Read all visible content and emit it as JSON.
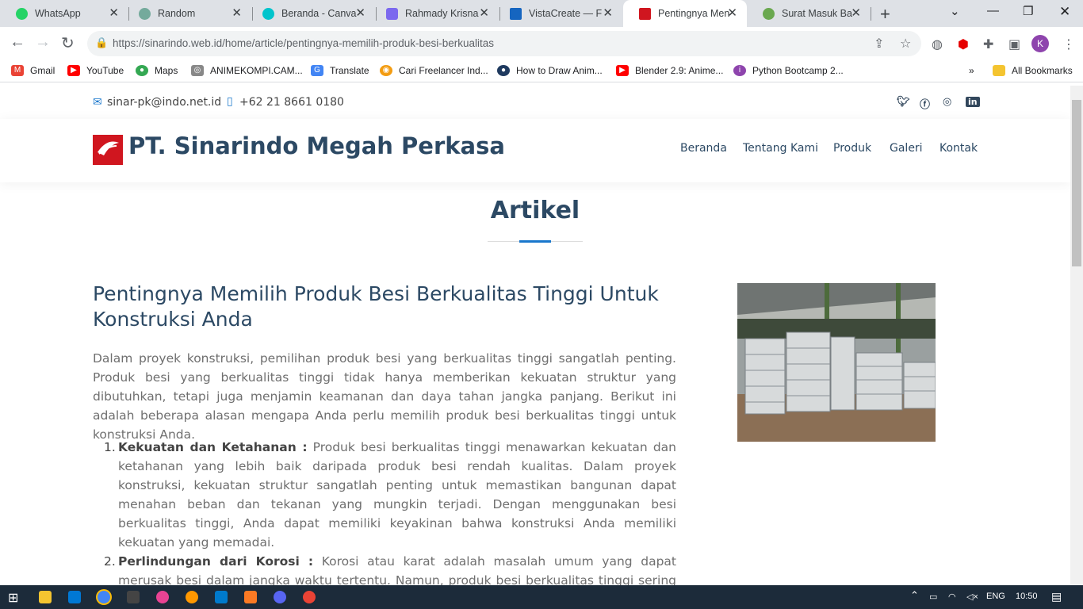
{
  "browser": {
    "tabs": [
      {
        "title": "WhatsApp",
        "color": "#25d366"
      },
      {
        "title": "Random",
        "color": "#74aa9c"
      },
      {
        "title": "Beranda - Canva",
        "color": "#00c4cc"
      },
      {
        "title": "Rahmady Krisna",
        "color": "#7b68ee"
      },
      {
        "title": "VistaCreate — F",
        "color": "#1565c0"
      },
      {
        "title": "Pentingnya Men",
        "color": "#d0161f"
      },
      {
        "title": "Surat Masuk Ba",
        "color": "#6aa84f"
      }
    ],
    "url_host": "https://sinarindo.web.id",
    "url_path": "/home/article/pentingnya-memilih-produk-besi-berkualitas",
    "avatar_letter": "K",
    "bookmarks": [
      {
        "label": "Gmail",
        "color": "#ea4335",
        "glyph": "M"
      },
      {
        "label": "YouTube",
        "color": "#ff0000",
        "glyph": "▶"
      },
      {
        "label": "Maps",
        "color": "#34a853",
        "glyph": "●"
      },
      {
        "label": "ANIMEKOMPI.CAM...",
        "color": "#888888",
        "glyph": "◎"
      },
      {
        "label": "Translate",
        "color": "#4285f4",
        "glyph": "G"
      },
      {
        "label": "Cari Freelancer Ind...",
        "color": "#f39c12",
        "glyph": "◉"
      },
      {
        "label": "How to Draw Anim...",
        "color": "#1f3a5f",
        "glyph": "●"
      },
      {
        "label": "Blender 2.9: Anime...",
        "color": "#ff0000",
        "glyph": "▶"
      },
      {
        "label": "Python Bootcamp 2...",
        "color": "#8e44ad",
        "glyph": "i"
      }
    ],
    "all_bookmarks": "All Bookmarks"
  },
  "site": {
    "email": "sinar-pk@indo.net.id",
    "phone": "+62 21 8661 0180",
    "company": "PT. Sinarindo Megah Perkasa",
    "logo_text": "Sinarindo",
    "nav": [
      "Beranda",
      "Tentang Kami",
      "Produk",
      "Galeri",
      "Kontak"
    ],
    "section_title": "Artikel"
  },
  "article": {
    "title": "Pentingnya Memilih Produk Besi Berkualitas Tinggi Untuk Konstruksi Anda",
    "intro": "Dalam proyek konstruksi, pemilihan produk besi yang berkualitas tinggi sangatlah penting. Produk besi yang berkualitas tinggi tidak hanya memberikan kekuatan struktur yang dibutuhkan, tetapi juga menjamin keamanan dan daya tahan jangka panjang. Berikut ini adalah beberapa alasan mengapa Anda perlu memilih produk besi berkualitas tinggi untuk konstruksi Anda.",
    "points": [
      {
        "num": "1.",
        "head": "Kekuatan dan Ketahanan :",
        "body": " Produk besi berkualitas tinggi menawarkan kekuatan dan ketahanan yang lebih baik daripada produk besi rendah kualitas. Dalam proyek konstruksi, kekuatan struktur sangatlah penting untuk memastikan bangunan dapat menahan beban dan tekanan yang mungkin terjadi. Dengan menggunakan besi berkualitas tinggi, Anda dapat memiliki keyakinan bahwa konstruksi Anda memiliki kekuatan yang memadai."
      },
      {
        "num": "2.",
        "head": "Perlindungan dari Korosi :",
        "body": " Korosi atau karat adalah masalah umum yang dapat merusak besi dalam jangka waktu tertentu. Namun, produk besi berkualitas tinggi sering dilapisi dengan lapisan anti-korosi, seperti galvanisasi atau pelapisan khusus. Lapisan ini membantu"
      }
    ]
  },
  "taskbar": {
    "lang": "ENG",
    "time": "10:50"
  }
}
